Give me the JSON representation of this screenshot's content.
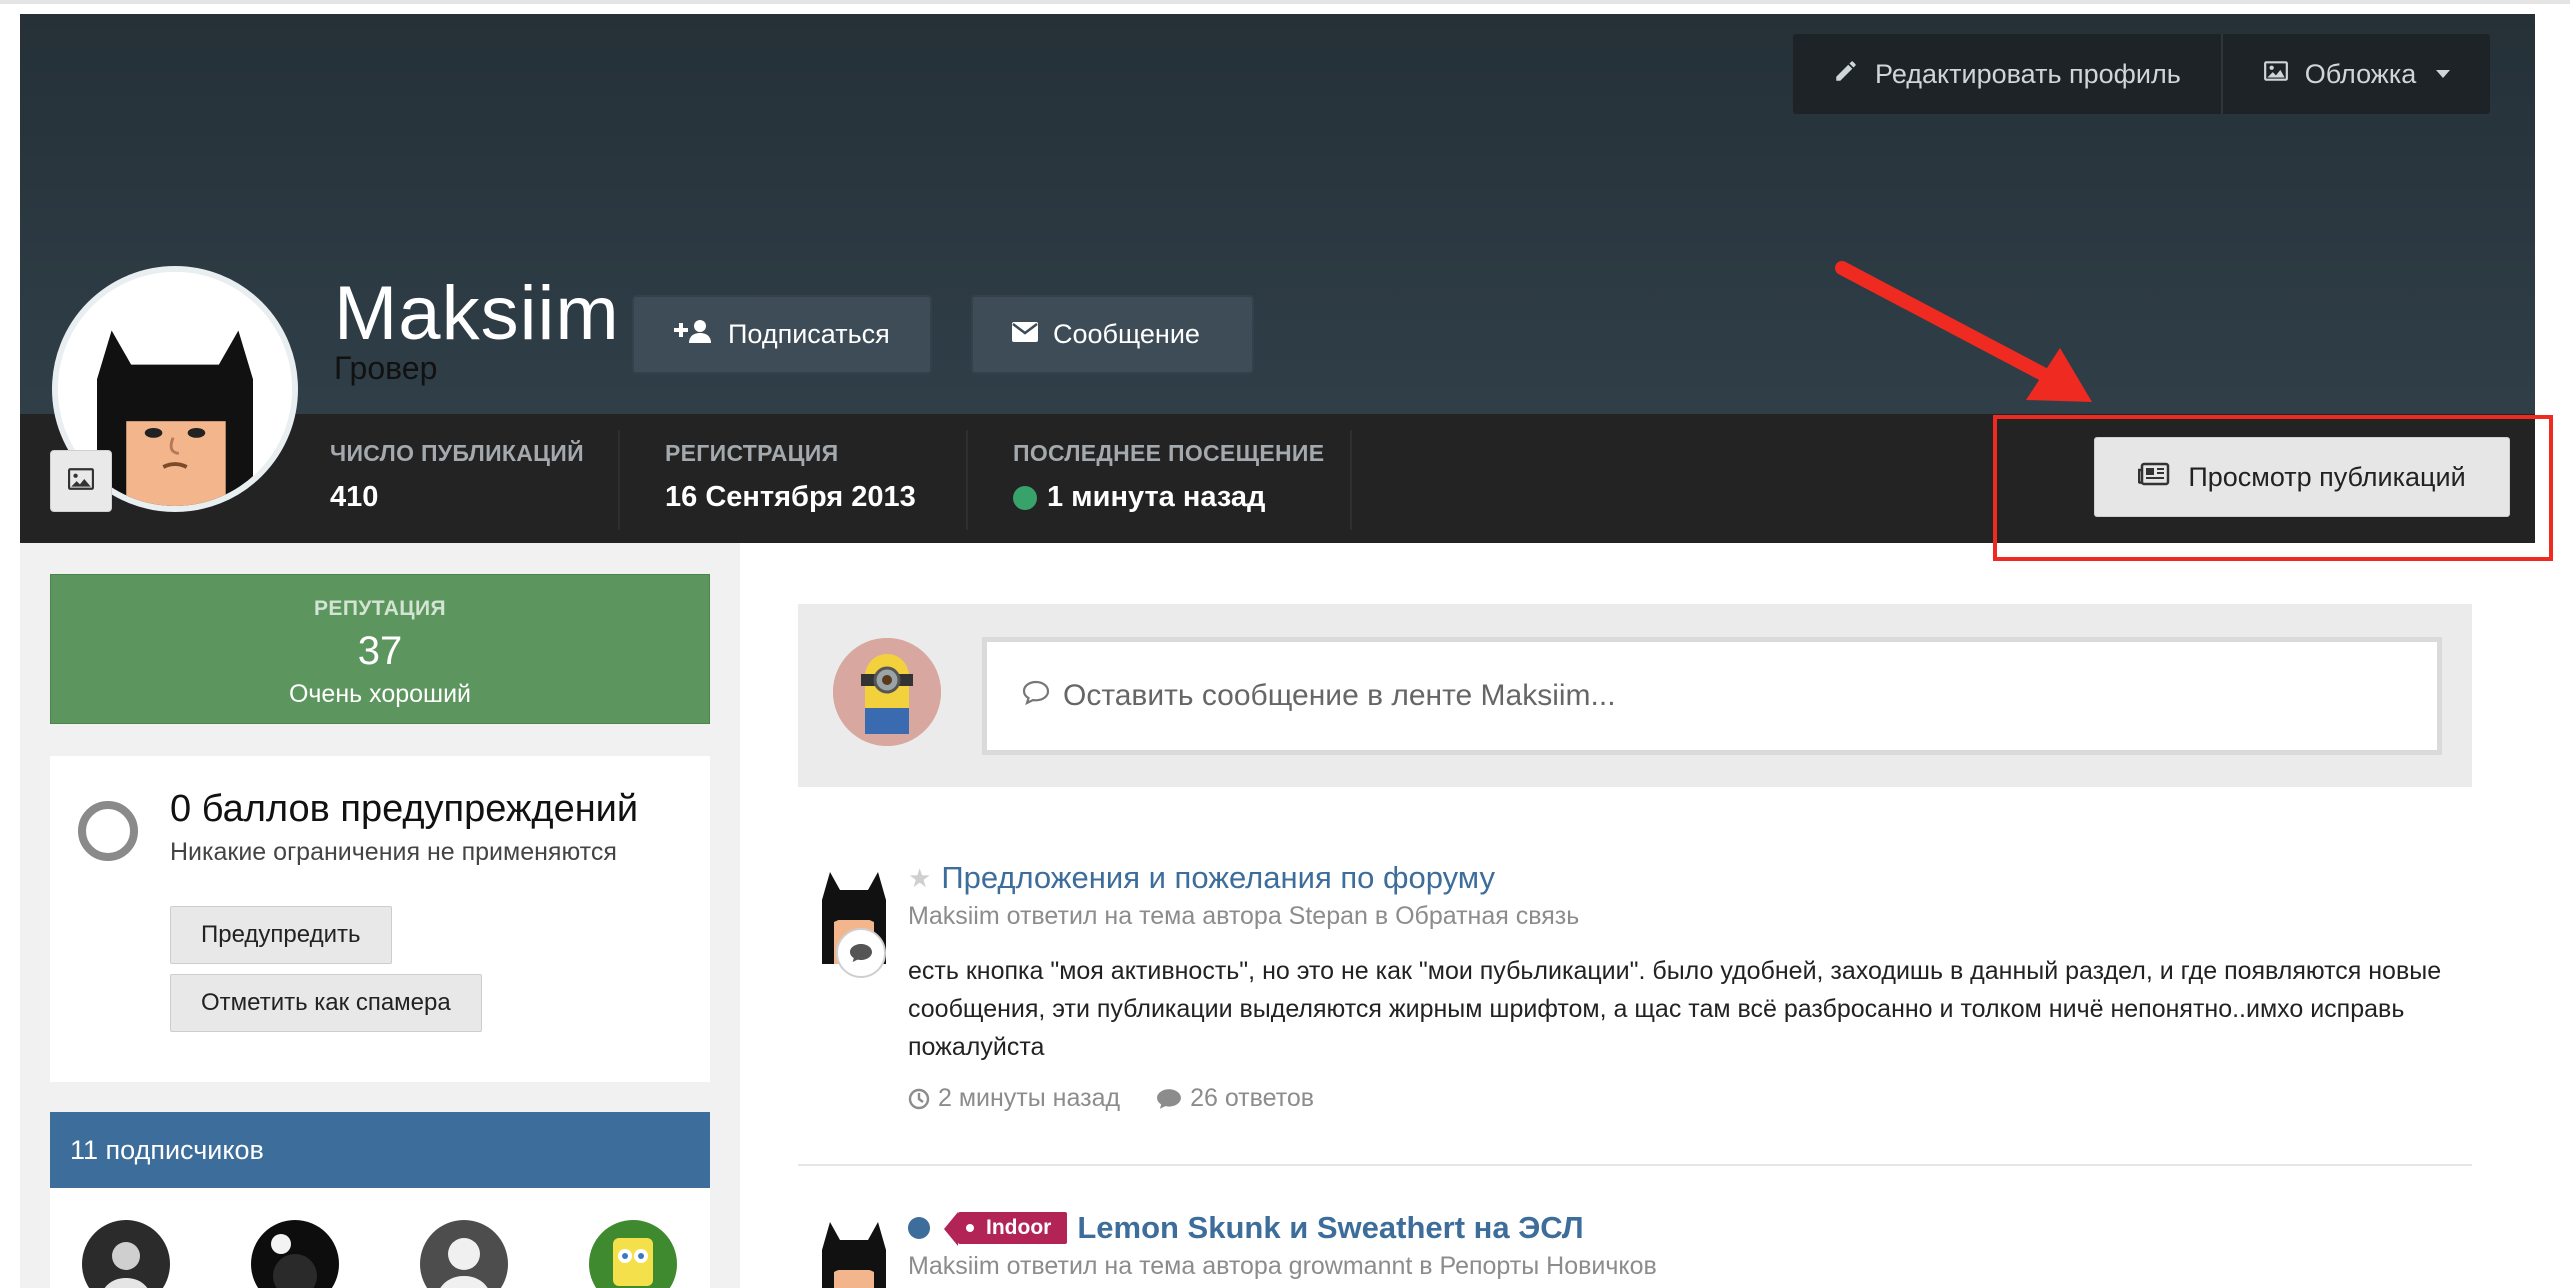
{
  "cover": {
    "edit_profile": "Редактировать профиль",
    "cover_menu": "Обложка"
  },
  "profile": {
    "username": "Maksiim",
    "rank": "Гровер",
    "follow_label": "Подписаться",
    "message_label": "Сообщение",
    "stats": [
      {
        "label": "ЧИСЛО ПУБЛИКАЦИЙ",
        "value": "410"
      },
      {
        "label": "РЕГИСТРАЦИЯ",
        "value": "16 Сентября 2013"
      },
      {
        "label": "ПОСЛЕДНЕЕ ПОСЕЩЕНИЕ",
        "value": "1 минута назад"
      }
    ],
    "view_posts_label": "Просмотр публикаций"
  },
  "sidebar": {
    "reputation": {
      "label": "РЕПУТАЦИЯ",
      "value": "37",
      "text": "Очень хороший"
    },
    "warnings": {
      "title": "0 баллов предупреждений",
      "subtitle": "Никакие ограничения не применяются",
      "warn_button": "Предупредить",
      "spam_button": "Отметить как спамера"
    },
    "followers": {
      "title": "11 подписчиков"
    }
  },
  "status": {
    "placeholder": "Оставить сообщение в ленте Maksiim..."
  },
  "feed": [
    {
      "title": "Предложения и пожелания по форуму",
      "meta": "Maksiim ответил на тема автора Stepan в Обратная связь",
      "body": "есть кнопка \"моя активность\", но это не как \"мои пубьликации\". было удобней, заходишь в данный раздел, и где появляются новые сообщения, эти публикации выделяются жирным шрифтом, а щас там всё разбросанно и толком ничё непонятно..имхо исправь пожалуйста",
      "time": "2 минуты назад",
      "replies": "26 ответов"
    },
    {
      "tag": "Indoor",
      "title": "Lemon Skunk и Sweathert на ЭСЛ",
      "meta": "Maksiim ответил на тема автора growmannt в Репорты Новичков"
    }
  ],
  "colors": {
    "cover": "#2d3b44",
    "stats_bar": "#232323",
    "reputation": "#5c965e",
    "followers_header": "#3d6d9a",
    "link": "#3d6d9a",
    "highlight": "#ee2a21",
    "online": "#37a36b",
    "tag": "#b22456"
  }
}
